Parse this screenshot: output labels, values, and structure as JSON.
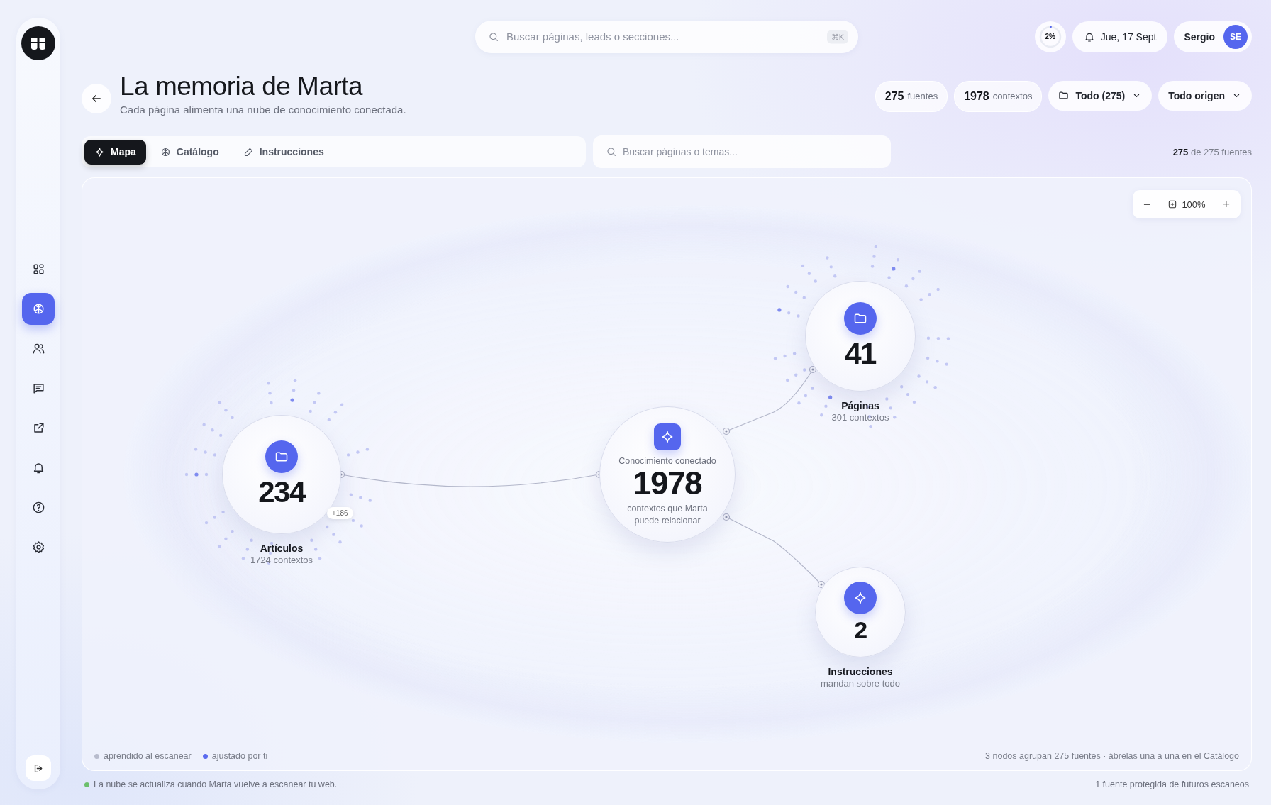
{
  "sidebar": {
    "items": [
      {
        "kind": "dashboard",
        "selected": false
      },
      {
        "kind": "brain",
        "selected": true
      },
      {
        "kind": "people",
        "selected": false
      },
      {
        "kind": "chat",
        "selected": false
      },
      {
        "kind": "external",
        "selected": false
      },
      {
        "kind": "bell",
        "selected": false
      },
      {
        "kind": "help",
        "selected": false
      },
      {
        "kind": "settings",
        "selected": false
      }
    ],
    "footer_item": {
      "kind": "logout"
    }
  },
  "top_bar": {
    "search": {
      "placeholder": "Buscar páginas, leads o secciones...",
      "shortcut": "⌘K"
    },
    "progress": {
      "text": "2%",
      "level": 0.02
    },
    "date": "Jue, 17 Sept",
    "user": {
      "name": "Sergio",
      "initials": "SE"
    }
  },
  "header": {
    "title": "La memoria de Marta",
    "subtitle": "Cada página alimenta una nube de conocimiento conectada.",
    "stats": [
      {
        "value": "275",
        "unit": "fuentes"
      },
      {
        "value": "1978",
        "unit": "contextos"
      }
    ],
    "filters": [
      {
        "label": "Todo (275)",
        "kind": "folder"
      },
      {
        "label": "Todo origen",
        "kind": "plain"
      }
    ]
  },
  "tabs": [
    {
      "label": "Mapa",
      "kind": "sparkle",
      "selected": true
    },
    {
      "label": "Catálogo",
      "kind": "brain",
      "selected": false
    },
    {
      "label": "Instrucciones",
      "kind": "pencil",
      "selected": false
    }
  ],
  "search": {
    "placeholder": "Buscar páginas o temas..."
  },
  "result_count": {
    "value": "275",
    "rest": "de 275 fuentes"
  },
  "map": {
    "zoom": {
      "minus": "−",
      "value": "100%",
      "plus": "+"
    },
    "nodes": [
      {
        "kind": "folder",
        "count": "234",
        "label": "Artículos",
        "sub": "1724 contextos",
        "badge": "+186"
      },
      {
        "kind": "hub",
        "caption": "Conocimiento conectado",
        "count": "1978",
        "sub": "contextos que Marta puede relacionar"
      },
      {
        "kind": "folder",
        "count": "41",
        "label": "Páginas",
        "sub": "301 contextos"
      },
      {
        "kind": "instruction",
        "count": "2",
        "label": "Instrucciones",
        "sub": "mandan sobre todo"
      }
    ],
    "legend": [
      {
        "label": "aprendido al escanear",
        "color": "#b8bccd"
      },
      {
        "label": "ajustado por ti",
        "color": "#5b6bef"
      }
    ],
    "summary": "3 nodos agrupan 275 fuentes · ábrelas una a una en el Catálogo"
  },
  "footer": {
    "status": "La nube se actualiza cuando Marta vuelve a escanear tu web.",
    "note": "1 fuente protegida de futuros escaneos"
  }
}
